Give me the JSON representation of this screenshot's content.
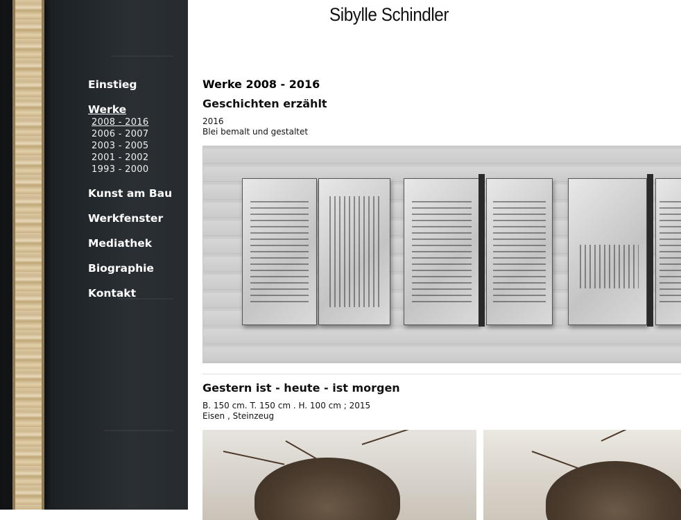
{
  "site": {
    "title": "Sibylle Schindler"
  },
  "nav": {
    "items": [
      {
        "label": "Einstieg"
      },
      {
        "label": "Werke",
        "active": true,
        "sub": [
          {
            "label": "2008 - 2016",
            "active": true
          },
          {
            "label": "2006 - 2007"
          },
          {
            "label": "2003 - 2005"
          },
          {
            "label": "2001 - 2002"
          },
          {
            "label": "1993 - 2000"
          }
        ]
      },
      {
        "label": "Kunst am Bau"
      },
      {
        "label": "Werkfenster"
      },
      {
        "label": "Mediathek"
      },
      {
        "label": "Biographie"
      },
      {
        "label": "Kontakt"
      }
    ]
  },
  "main": {
    "section_title": "Werke 2008 - 2016",
    "works": [
      {
        "title": "Geschichten erzählt",
        "year": "2016",
        "material": "Blei bemalt und gestaltet"
      },
      {
        "title": "Gestern ist - heute - ist morgen",
        "dimensions": "B. 150 cm. T. 150 cm . H. 100 cm ; 2015",
        "material": "Eisen , Steinzeug"
      }
    ]
  },
  "colors": {
    "sidebar": "#1d2226",
    "link": "#ffffff",
    "text": "#000000"
  }
}
